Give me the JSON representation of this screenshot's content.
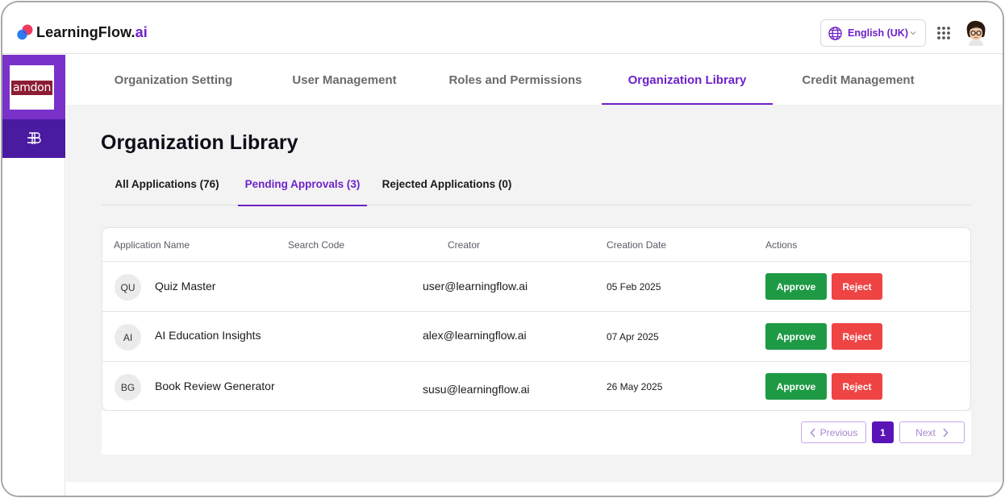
{
  "brand": {
    "name_main": "LearningFlow.",
    "name_accent": "ai"
  },
  "header": {
    "language": "English (UK)",
    "icons": [
      "globe-icon",
      "chevron-down-icon",
      "apps-grid-icon",
      "user-avatar"
    ]
  },
  "org": {
    "logo_text": "amdon"
  },
  "sidebar": {
    "items": [
      {
        "icon": "library-stack-icon"
      }
    ]
  },
  "nav": {
    "tabs": [
      {
        "label": "Organization Setting",
        "active": false
      },
      {
        "label": "User Management",
        "active": false
      },
      {
        "label": "Roles and Permissions",
        "active": false
      },
      {
        "label": "Organization Library",
        "active": true
      },
      {
        "label": "Credit Management",
        "active": false
      }
    ]
  },
  "page": {
    "title": "Organization Library"
  },
  "subtabs": [
    {
      "label": "All Applications (76)",
      "active": false
    },
    {
      "label": "Pending Approvals (3)",
      "active": true
    },
    {
      "label": "Rejected Applications (0)",
      "active": false
    }
  ],
  "table": {
    "columns": [
      "Application Name",
      "Search Code",
      "Creator",
      "Creation Date",
      "Actions"
    ],
    "rows": [
      {
        "initials": "QU",
        "name": "Quiz Master",
        "search_code": "",
        "creator": "user@learningflow.ai",
        "date": "05 Feb 2025",
        "approve": "Approve",
        "reject": "Reject"
      },
      {
        "initials": "AI",
        "name": "AI Education Insights",
        "search_code": "",
        "creator": "alex@learningflow.ai",
        "date": "07 Apr 2025",
        "approve": "Approve",
        "reject": "Reject"
      },
      {
        "initials": "BG",
        "name": "Book Review Generator",
        "search_code": "",
        "creator": "susu@learningflow.ai",
        "date": "26 May 2025",
        "approve": "Approve",
        "reject": "Reject"
      }
    ]
  },
  "pagination": {
    "previous": "Previous",
    "current": "1",
    "next": "Next"
  },
  "colors": {
    "accent": "#6e22c9",
    "approve": "#1e9a45",
    "reject": "#ef4444",
    "page_active": "#5b14b8"
  }
}
